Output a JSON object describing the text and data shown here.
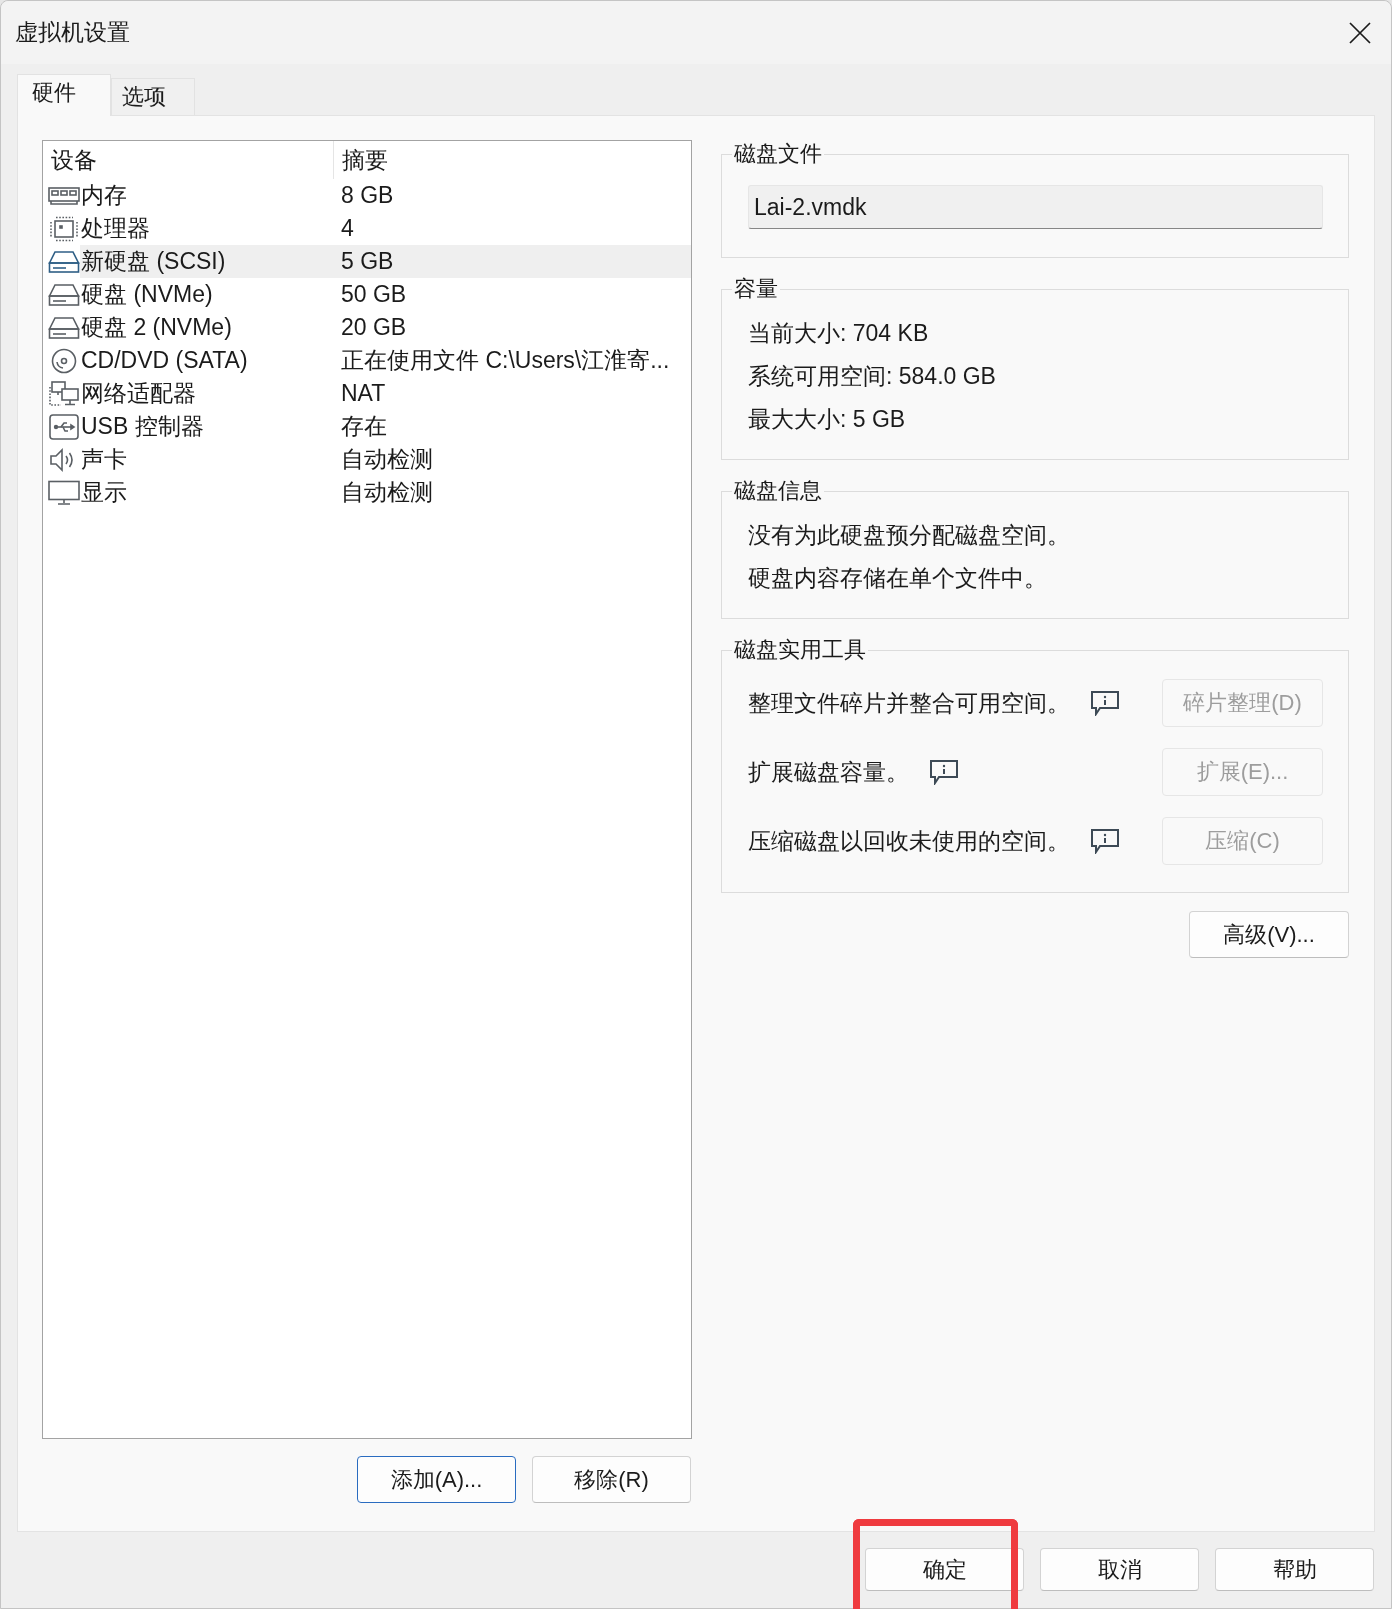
{
  "window": {
    "title": "虚拟机设置"
  },
  "tabs": [
    {
      "label": "硬件",
      "selected": true
    },
    {
      "label": "选项",
      "selected": false
    }
  ],
  "device_list": {
    "columns": [
      "设备",
      "摘要"
    ],
    "rows": [
      {
        "kind": "memory",
        "device": "内存",
        "summary": "8 GB",
        "selected": false
      },
      {
        "kind": "processor",
        "device": "处理器",
        "summary": "4",
        "selected": false
      },
      {
        "kind": "disk",
        "device": "新硬盘 (SCSI)",
        "summary": "5 GB",
        "selected": true
      },
      {
        "kind": "disk",
        "device": "硬盘 (NVMe)",
        "summary": "50 GB",
        "selected": false
      },
      {
        "kind": "disk",
        "device": "硬盘 2 (NVMe)",
        "summary": "20 GB",
        "selected": false
      },
      {
        "kind": "cdrom",
        "device": "CD/DVD (SATA)",
        "summary": "正在使用文件 C:\\Users\\江淮寄...",
        "selected": false
      },
      {
        "kind": "network",
        "device": "网络适配器",
        "summary": "NAT",
        "selected": false
      },
      {
        "kind": "usb",
        "device": "USB 控制器",
        "summary": "存在",
        "selected": false
      },
      {
        "kind": "sound",
        "device": "声卡",
        "summary": "自动检测",
        "selected": false
      },
      {
        "kind": "display",
        "device": "显示",
        "summary": "自动检测",
        "selected": false
      }
    ]
  },
  "list_buttons": [
    {
      "label": "添加(A)...",
      "focused": true
    },
    {
      "label": "移除(R)",
      "focused": false
    }
  ],
  "disk_file": {
    "title": "磁盘文件",
    "value": "Lai-2.vmdk"
  },
  "capacity": {
    "title": "容量",
    "lines": [
      "当前大小: 704 KB",
      "系统可用空间: 584.0 GB",
      "最大大小: 5 GB"
    ]
  },
  "disk_info": {
    "title": "磁盘信息",
    "lines": [
      "没有为此硬盘预分配磁盘空间。",
      "硬盘内容存储在单个文件中。"
    ]
  },
  "disk_utilities": {
    "title": "磁盘实用工具",
    "items": [
      {
        "description": "整理文件碎片并整合可用空间。",
        "button": "碎片整理(D)",
        "disabled": true
      },
      {
        "description": "扩展磁盘容量。",
        "button": "扩展(E)...",
        "disabled": true
      },
      {
        "description": "压缩磁盘以回收未使用的空间。",
        "button": "压缩(C)",
        "disabled": true
      }
    ]
  },
  "advanced_button": "高级(V)...",
  "dialog_buttons": [
    {
      "label": "确定",
      "highlighted": true
    },
    {
      "label": "取消",
      "highlighted": false
    },
    {
      "label": "帮助",
      "highlighted": false
    }
  ]
}
